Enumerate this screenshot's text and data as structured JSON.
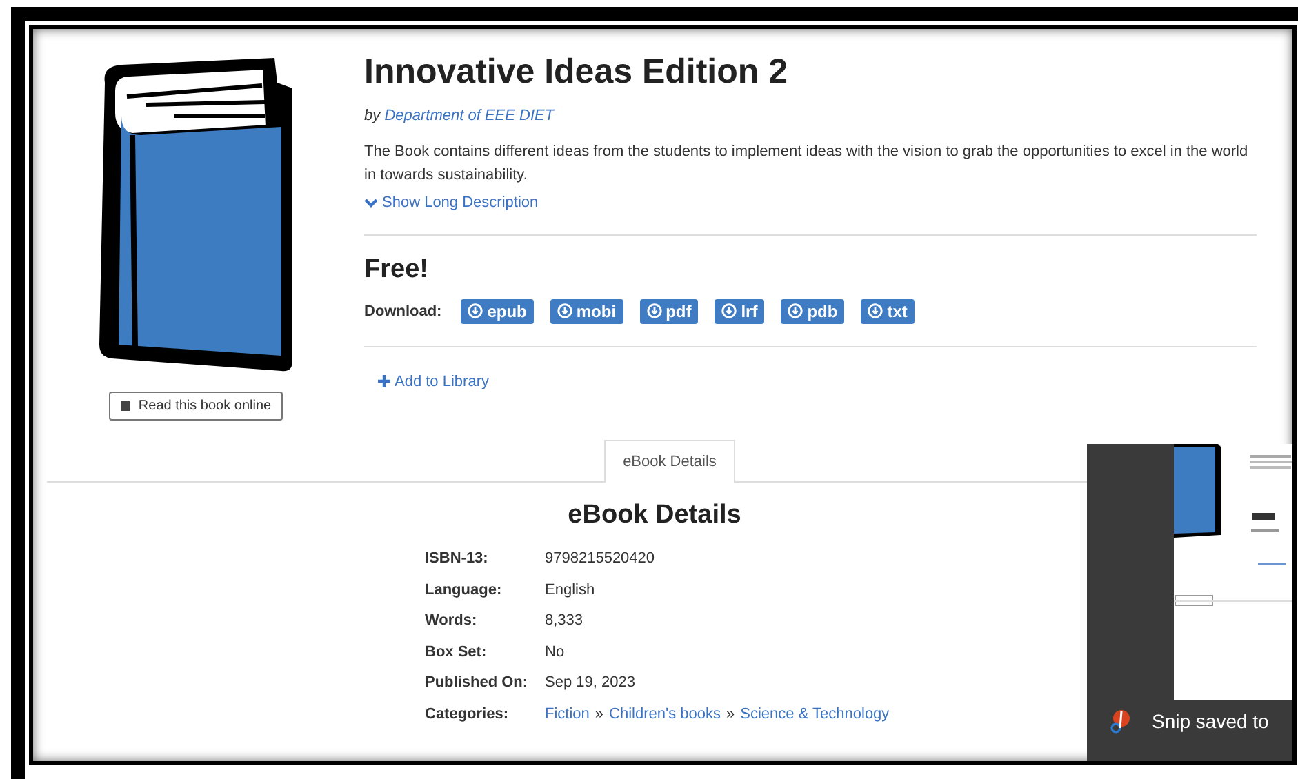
{
  "book": {
    "title": "Innovative Ideas Edition 2",
    "by": "by",
    "author": "Department of EEE DIET",
    "description": "The Book contains different ideas from the students to implement ideas with the vision to grab the opportunities to excel in the world in towards sustainability.",
    "show_more": "Show Long Description",
    "read_online": "Read this book online",
    "price": "Free!",
    "download_label": "Download:",
    "formats": [
      "epub",
      "mobi",
      "pdf",
      "lrf",
      "pdb",
      "txt"
    ],
    "add_to_library": "Add to Library"
  },
  "tabs": [
    {
      "label": "eBook Details",
      "selected": true
    }
  ],
  "details": {
    "heading": "eBook Details",
    "rows": [
      {
        "kind": "text",
        "label": "ISBN-13:",
        "value": "9798215520420"
      },
      {
        "kind": "text",
        "label": "Language:",
        "value": "English"
      },
      {
        "kind": "text",
        "label": "Words:",
        "value": "8,333"
      },
      {
        "kind": "text",
        "label": "Box Set:",
        "value": "No"
      },
      {
        "kind": "text",
        "label": "Published On:",
        "value": "Sep 19, 2023"
      },
      {
        "kind": "links",
        "label": "Categories:",
        "items": [
          {
            "kind": "link",
            "text": "Fiction"
          },
          {
            "kind": "separator",
            "text": "»"
          },
          {
            "kind": "link",
            "text": "Children's books"
          },
          {
            "kind": "separator",
            "text": "»"
          },
          {
            "kind": "link",
            "text": "Science & Technology"
          }
        ]
      }
    ]
  },
  "notification": {
    "text": "Snip saved to"
  }
}
